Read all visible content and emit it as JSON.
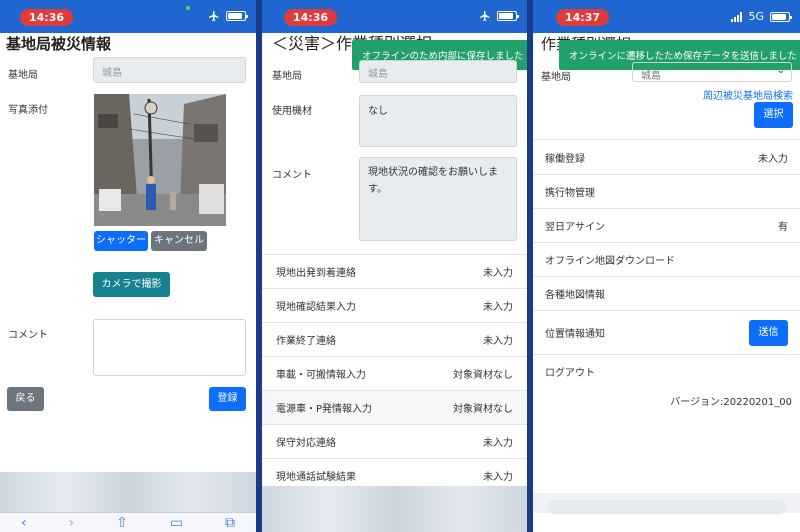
{
  "screen1": {
    "time": "14:36",
    "title": "基地局被災情報",
    "station_label": "基地局",
    "station_value": "城島",
    "photo_label": "写真添付",
    "shutter_button": "シャッター",
    "cancel_button": "キャンセル",
    "camera_button": "カメラで撮影",
    "comment_label": "コメント",
    "back_button": "戻る",
    "register_button": "登録"
  },
  "screen2": {
    "time": "14:36",
    "title": "＜災害＞作業種別選択",
    "toast": "オフラインのため内部に保存しました",
    "station_label": "基地局",
    "station_value": "城島",
    "equipment_label": "使用機材",
    "equipment_value": "なし",
    "comment_label": "コメント",
    "comment_value": "現地状況の確認をお願いします。",
    "rows": [
      {
        "label": "現地出発到着連絡",
        "value": "未入力"
      },
      {
        "label": "現地確認結果入力",
        "value": "未入力"
      },
      {
        "label": "作業終了連絡",
        "value": "未入力"
      },
      {
        "label": "車載・可搬情報入力",
        "value": "対象資材なし"
      },
      {
        "label": "電源車・P発情報入力",
        "value": "対象資材なし"
      },
      {
        "label": "保守対応連絡",
        "value": "未入力"
      },
      {
        "label": "現地通話試験結果",
        "value": "未入力"
      }
    ]
  },
  "screen3": {
    "time": "14:37",
    "network": "5G",
    "title": "作業種別選択",
    "toast": "オンラインに遷移したため保存データを送信しました",
    "station_label": "基地局",
    "station_value": "城島",
    "nearby_link": "周辺被災基地局検索",
    "select_button": "選択",
    "rows": [
      {
        "label": "稼働登録",
        "value": "未入力"
      },
      {
        "label": "携行物管理",
        "value": ""
      },
      {
        "label": "翌日アサイン",
        "value": "有"
      },
      {
        "label": "オフライン地図ダウンロード",
        "value": ""
      },
      {
        "label": "各種地図情報",
        "value": ""
      }
    ],
    "location_label": "位置情報通知",
    "send_button": "送信",
    "logout": "ログアウト",
    "version": "バージョン:20220201_00"
  },
  "colors": {
    "statusbar": "#1f66d1",
    "primary": "#0d6efd",
    "toast": "#22a06b",
    "time_pill": "#e03a3a"
  }
}
